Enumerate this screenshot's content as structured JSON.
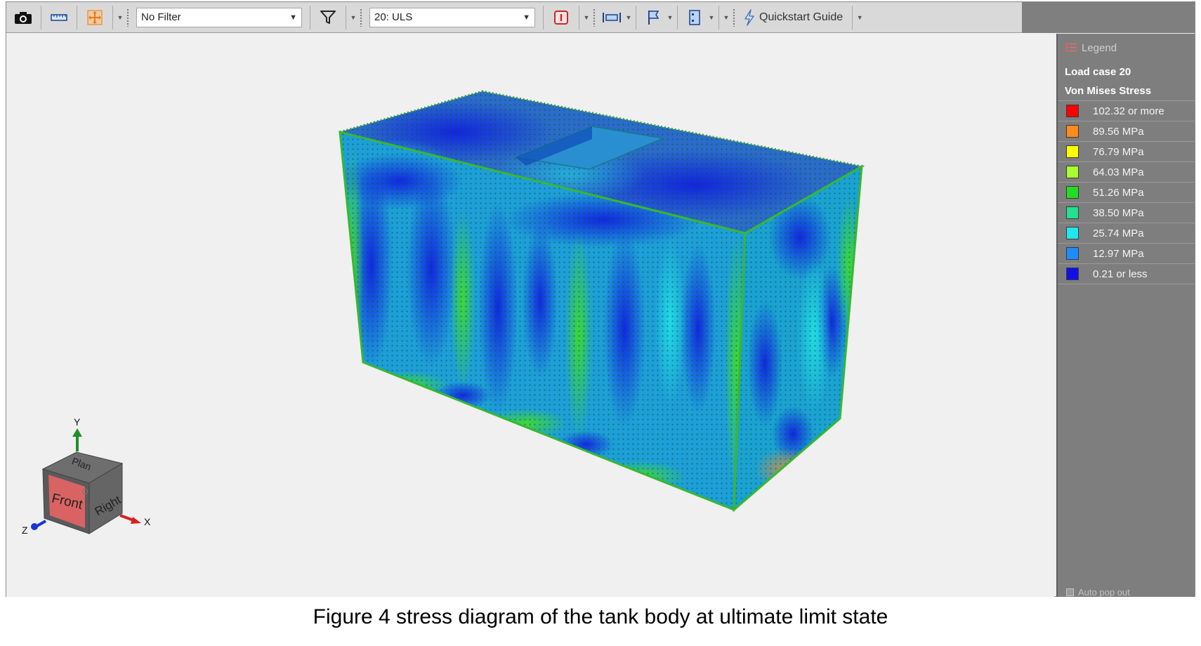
{
  "toolbar": {
    "filter": {
      "value": "No Filter"
    },
    "load_case": {
      "value": "20: ULS"
    },
    "quickstart": {
      "label": "Quickstart Guide"
    }
  },
  "view_cube": {
    "faces": {
      "top": "Plan",
      "front": "Front",
      "right": "Right"
    },
    "axes": {
      "y": "Y",
      "x": "X",
      "z": "Z"
    }
  },
  "legend": {
    "header": "Legend",
    "load_case": "Load case 20",
    "result": "Von Mises Stress",
    "rows": [
      {
        "label": "102.32 or more",
        "color": "#ff0000"
      },
      {
        "label": "89.56 MPa",
        "color": "#ff8c1a"
      },
      {
        "label": "76.79 MPa",
        "color": "#ffff00"
      },
      {
        "label": "64.03 MPa",
        "color": "#a8ff2e"
      },
      {
        "label": "51.26 MPa",
        "color": "#22dd22"
      },
      {
        "label": "38.50 MPa",
        "color": "#22e08c"
      },
      {
        "label": "25.74 MPa",
        "color": "#22e6ee"
      },
      {
        "label": "12.97 MPa",
        "color": "#1e8cff"
      },
      {
        "label": "0.21 or less",
        "color": "#1010e6"
      }
    ],
    "auto_popout": "Auto pop out"
  },
  "caption": "Figure 4 stress diagram of the tank body at ultimate limit state"
}
